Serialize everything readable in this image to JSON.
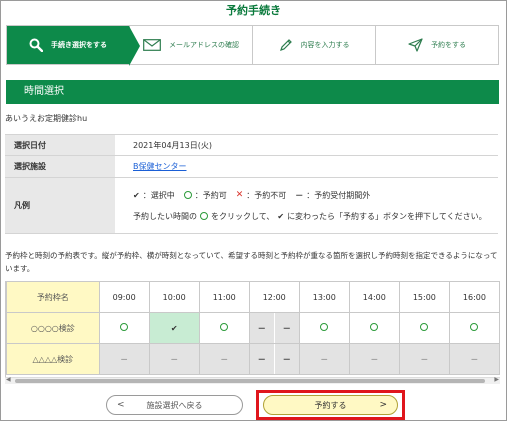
{
  "page": {
    "title": "予約手続き"
  },
  "steps": [
    {
      "label": "手続き選択をする",
      "icon": "search-icon",
      "active": true
    },
    {
      "label": "メールアドレスの確認",
      "icon": "mail-icon",
      "active": false
    },
    {
      "label": "内容を入力する",
      "icon": "pencil-icon",
      "active": false
    },
    {
      "label": "予約をする",
      "icon": "send-icon",
      "active": false
    }
  ],
  "section": {
    "title": "時間選択"
  },
  "course_name": "あいうえお定期健診hu",
  "info": {
    "date_label": "選択日付",
    "date_value": "2021年04月13日(火)",
    "facility_label": "選択施設",
    "facility_value": "B保健センター",
    "legend_label": "凡例",
    "legend": {
      "check_sym": "✔",
      "selected": "：選択中",
      "available": "：予約可",
      "x_sym": "✕",
      "unavailable": "：予約不可",
      "dash_sym": "－",
      "out_of_period": "：予約受付期間外",
      "instr_pre": "予約したい時間の",
      "instr_mid": "をクリックして、",
      "instr_post": "に変わったら「予約する」ボタンを押下してください。"
    }
  },
  "note": "予約枠と時刻の予約表です。縦が予約枠、横が時刻となっていて、希望する時刻と予約枠が重なる箇所を選択し予約時刻を指定できるようになっています。",
  "grid": {
    "corner_label": "予約枠名",
    "times": [
      "09:00",
      "10:00",
      "11:00",
      "12:00",
      "13:00",
      "14:00",
      "15:00",
      "16:00"
    ],
    "dash": "－",
    "check": "✔",
    "rows": [
      {
        "name": "○○○○検診",
        "cells": [
          "available",
          "selected",
          "available",
          "split-na",
          "available",
          "available",
          "available",
          "available"
        ]
      },
      {
        "name": "△△△△検診",
        "cells": [
          "na",
          "na",
          "na",
          "split-na",
          "na",
          "na",
          "na",
          "na"
        ]
      }
    ]
  },
  "buttons": {
    "back_label": "施設選択へ戻る",
    "back_arrow": "<",
    "next_label": "予約する",
    "next_arrow": ">"
  },
  "colors": {
    "brand_green": "#0d8a4a",
    "available_circle": "#2c9a3a",
    "unavailable_x": "#d9342b",
    "highlight_red": "#e0161c",
    "frame_yellow": "#fff9c4"
  }
}
